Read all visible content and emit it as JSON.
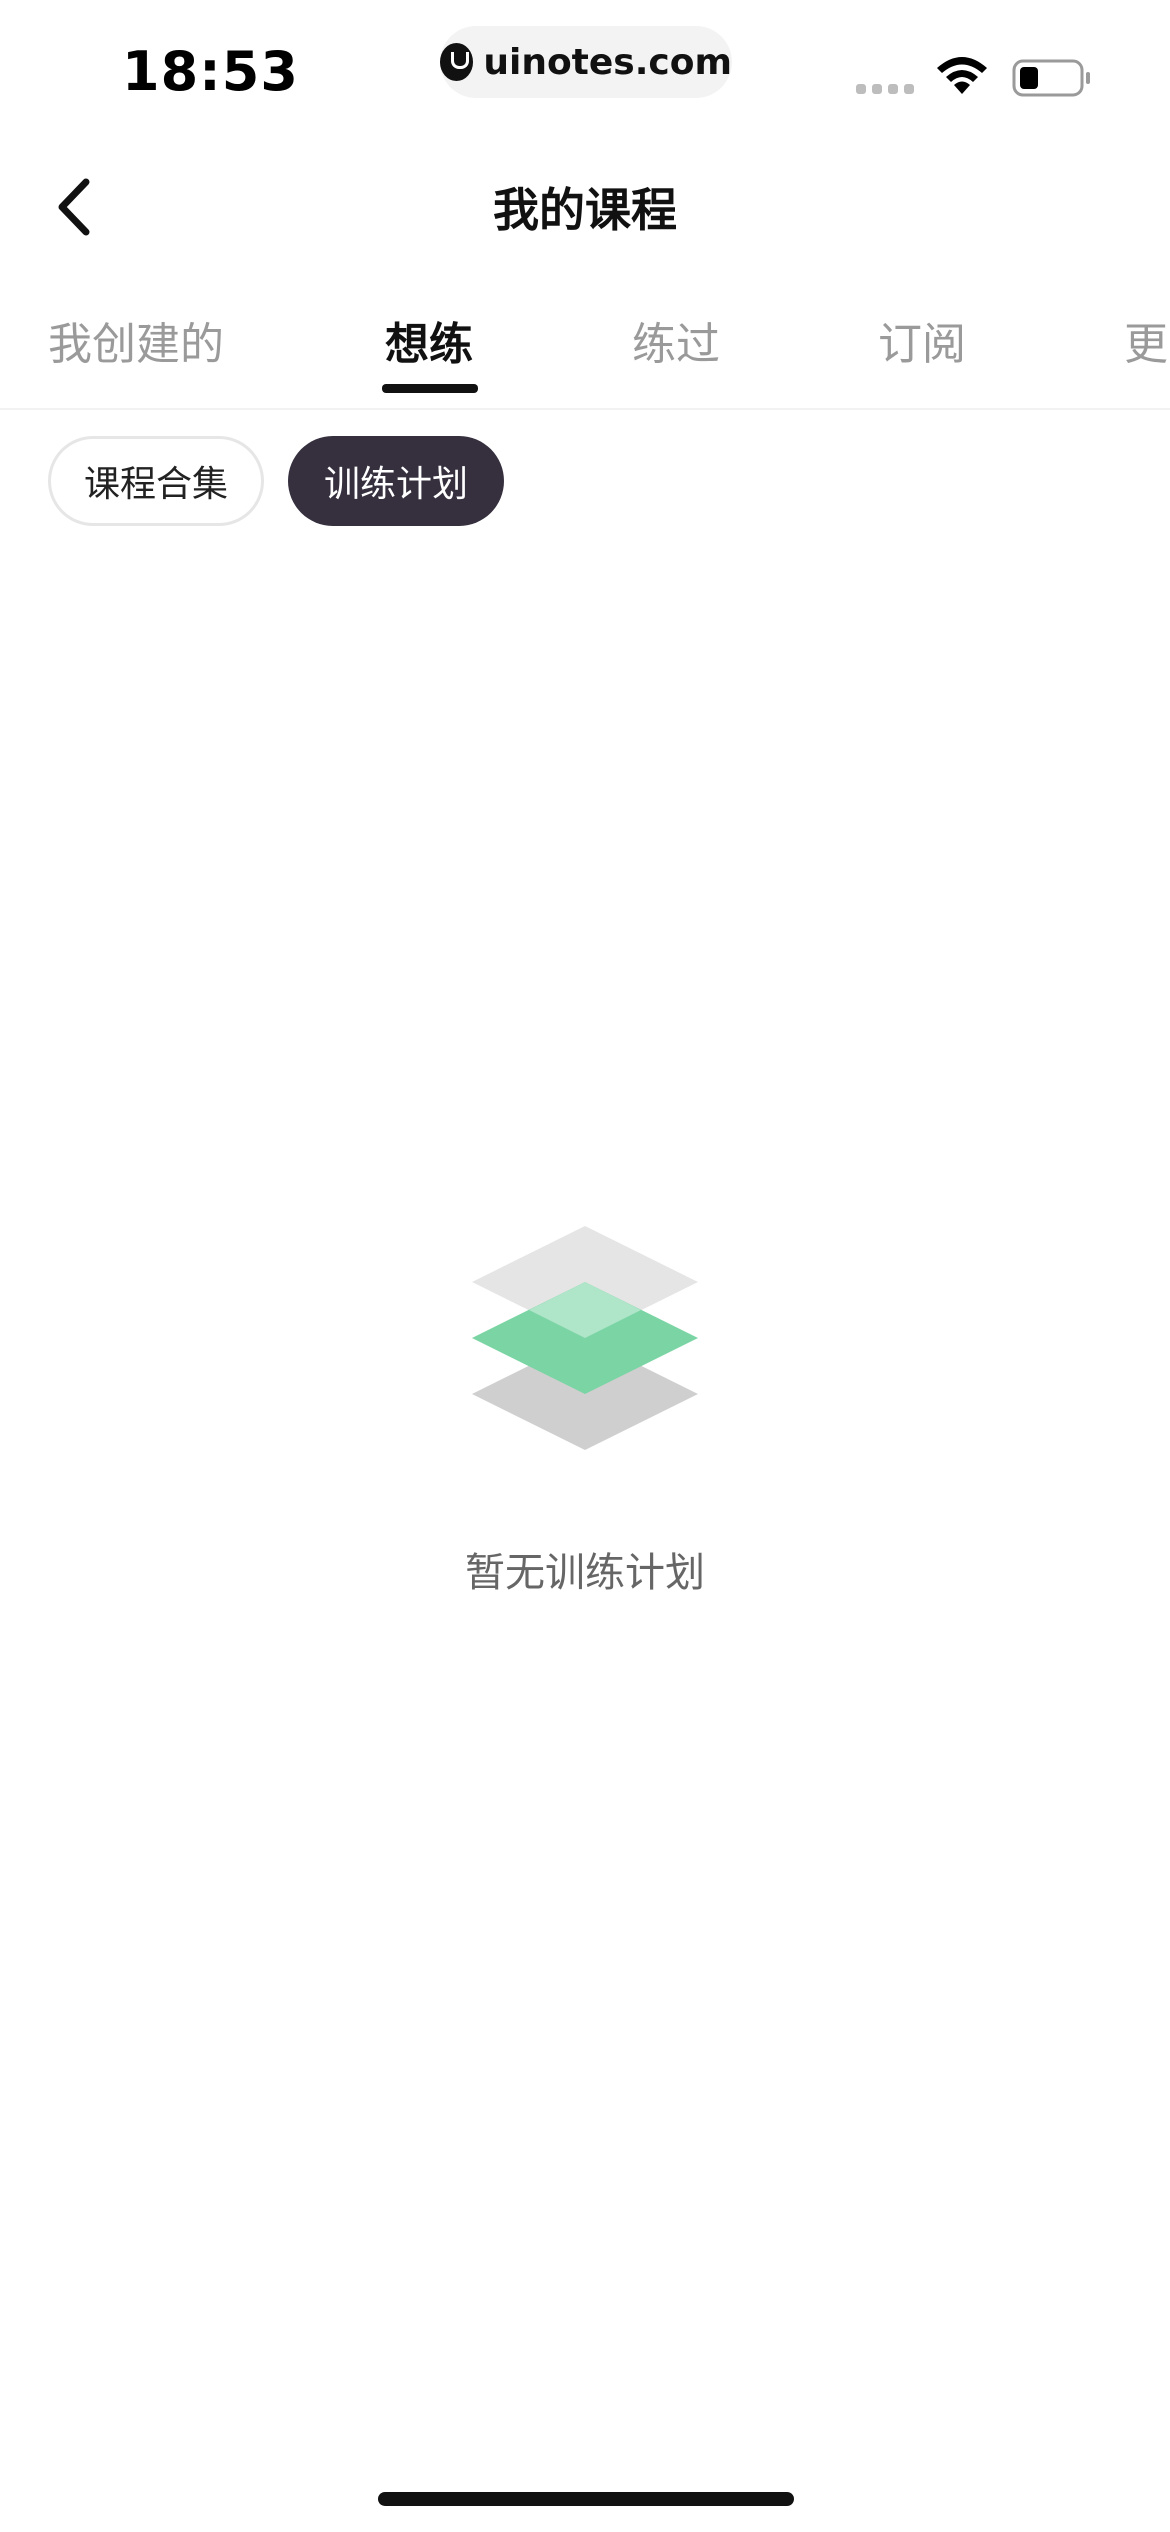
{
  "status_bar": {
    "time": "18:53",
    "url": "uinotes.com",
    "icons": [
      "signal-icon",
      "wifi-icon",
      "battery-icon"
    ]
  },
  "nav": {
    "title": "我的课程",
    "back_icon": "chevron-left-icon"
  },
  "tabs": [
    {
      "label": "我创建的",
      "active": false
    },
    {
      "label": "想练",
      "active": true
    },
    {
      "label": "练过",
      "active": false
    },
    {
      "label": "订阅",
      "active": false
    },
    {
      "label": "更",
      "active": false
    }
  ],
  "filters": [
    {
      "label": "课程合集",
      "selected": false
    },
    {
      "label": "训练计划",
      "selected": true
    }
  ],
  "empty_state": {
    "icon": "layers-icon",
    "message": "暂无训练计划"
  },
  "colors": {
    "accent_green": "#7ad4a4",
    "chip_selected_bg": "#352f3e",
    "text_muted": "#9a9a9a"
  }
}
